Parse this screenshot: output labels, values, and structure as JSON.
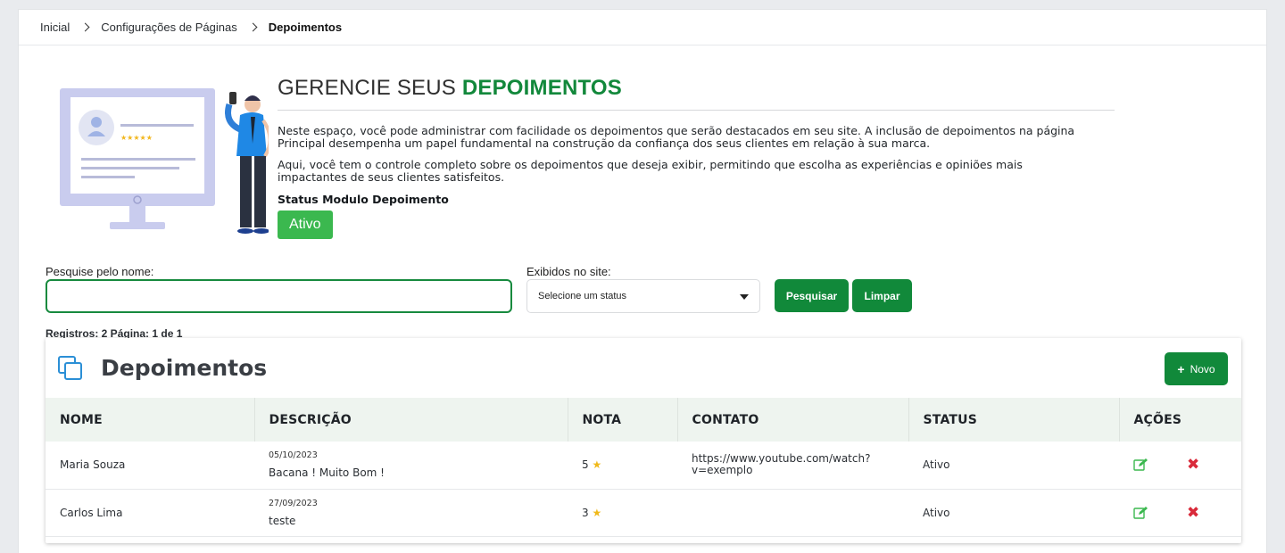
{
  "breadcrumb": {
    "items": [
      "Inicial",
      "Configurações de Páginas"
    ],
    "current": "Depoimentos"
  },
  "hero": {
    "title_plain": "GERENCIE SEUS ",
    "title_accent": "DEPOIMENTOS",
    "paragraph1": "Neste espaço, você pode administrar com facilidade os depoimentos que serão destacados em seu site. A inclusão de depoimentos na página Principal desempenha um papel fundamental na construção da confiança dos seus clientes em relação à sua marca.",
    "paragraph2": "Aqui, você tem o controle completo sobre os depoimentos que deseja exibir, permitindo que escolha as experiências e opiniões mais impactantes de seus clientes satisfeitos.",
    "status_label": "Status Modulo Depoimento",
    "status_value": "Ativo"
  },
  "filters": {
    "name_label": "Pesquise pelo nome:",
    "name_value": "",
    "status_label": "Exibidos no site:",
    "status_selected": "Selecione um status",
    "search_button": "Pesquisar",
    "clear_button": "Limpar"
  },
  "records_info": "Registros: 2 Página: 1 de 1",
  "card": {
    "title": "Depoimentos",
    "new_button": "Novo"
  },
  "table": {
    "columns": [
      "NOME",
      "DESCRIÇÃO",
      "NOTA",
      "CONTATO",
      "STATUS",
      "AÇÕES"
    ],
    "rows": [
      {
        "name": "Maria Souza",
        "date": "05/10/2023",
        "description": "Bacana ! Muito Bom !",
        "rating": "5",
        "contact": "https://www.youtube.com/watch?v=exemplo",
        "status": "Ativo"
      },
      {
        "name": "Carlos Lima",
        "date": "27/09/2023",
        "description": "teste",
        "rating": "3",
        "contact": "",
        "status": "Ativo"
      }
    ]
  },
  "colors": {
    "primary_green": "#11893a",
    "accent_green": "#3bb84f",
    "danger_red": "#d92a3a",
    "star_yellow": "#f0b91a",
    "icon_blue": "#2b8fd6"
  }
}
